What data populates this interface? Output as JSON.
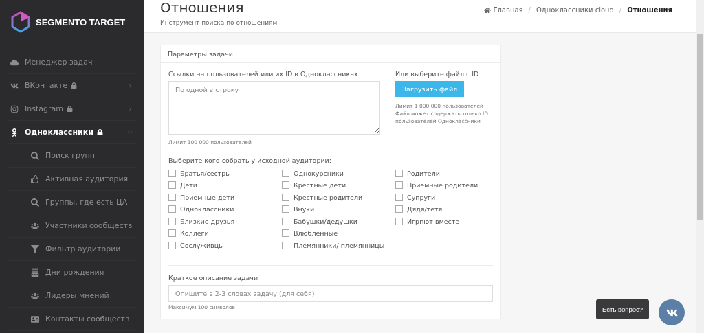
{
  "brand": {
    "name": "SEGMENTO TARGET"
  },
  "sidebar": {
    "items": [
      {
        "label": "Менеджер задач",
        "kind": "link",
        "locked": false,
        "selected": false
      },
      {
        "label": "ВКонтакте",
        "kind": "group",
        "locked": true,
        "expanded": false,
        "selected": false
      },
      {
        "label": "Instagram",
        "kind": "group",
        "locked": true,
        "expanded": false,
        "selected": false
      },
      {
        "label": "Одноклассники",
        "kind": "group",
        "locked": true,
        "expanded": true,
        "selected": true,
        "children": [
          {
            "label": "Поиск групп",
            "selected": false
          },
          {
            "label": "Активная аудитория",
            "selected": false
          },
          {
            "label": "Группы, где есть ЦА",
            "selected": false
          },
          {
            "label": "Участники сообществ",
            "selected": false
          },
          {
            "label": "Фильтр аудитории",
            "selected": false
          },
          {
            "label": "Дни рождения",
            "selected": false
          },
          {
            "label": "Лидеры мнений",
            "selected": false
          },
          {
            "label": "Контакты сообществ",
            "selected": false
          }
        ]
      }
    ]
  },
  "header": {
    "title": "Отношения",
    "subtitle": "Инструмент поиска по отношениям",
    "breadcrumbs": [
      {
        "label": "Главная",
        "current": false
      },
      {
        "label": "Одноклассники cloud",
        "current": false
      },
      {
        "label": "Отношения",
        "current": true
      }
    ],
    "separator": "/"
  },
  "card": {
    "title": "Параметры задачи",
    "links": {
      "label": "Ссылки на пользователей или их ID в Одноклассниках",
      "placeholder": "По одной в строку",
      "hint": "Лимит 100 000 пользователей"
    },
    "file": {
      "label": "Или выберите файл с ID",
      "button": "Загрузить файл",
      "hint": "Лимит 1 000 000 пользователей Файл может содержать только ID пользователей Одноклассники"
    },
    "audience": {
      "label": "Выберите кого собрать у исходной аудитории:",
      "columns": [
        [
          {
            "label": "Братья/сестры",
            "checked": false
          },
          {
            "label": "Дети",
            "checked": false
          },
          {
            "label": "Приемные дети",
            "checked": false
          },
          {
            "label": "Одноклассники",
            "checked": false
          },
          {
            "label": "Близкие друзья",
            "checked": false
          },
          {
            "label": "Коллеги",
            "checked": false
          },
          {
            "label": "Сослуживцы",
            "checked": false
          }
        ],
        [
          {
            "label": "Однокурсники",
            "checked": false
          },
          {
            "label": "Крестные дети",
            "checked": false
          },
          {
            "label": "Крестные родители",
            "checked": false
          },
          {
            "label": "Внуки",
            "checked": false
          },
          {
            "label": "Бабушки/дедушки",
            "checked": false
          },
          {
            "label": "Влюбленные",
            "checked": false
          },
          {
            "label": "Племянники/ племянницы",
            "checked": false
          }
        ],
        [
          {
            "label": "Родители",
            "checked": false
          },
          {
            "label": "Приемные родители",
            "checked": false
          },
          {
            "label": "Супруги",
            "checked": false
          },
          {
            "label": "Дядя/тетя",
            "checked": false
          },
          {
            "label": "Игрпют вместе",
            "checked": false
          }
        ]
      ]
    },
    "description": {
      "label": "Краткое описание задачи",
      "placeholder": "Опишите в 2-3 словах задачу (для себя)",
      "hint": "Максимум 100 символов"
    }
  },
  "chat": {
    "tooltip": "Есть вопрос?"
  }
}
